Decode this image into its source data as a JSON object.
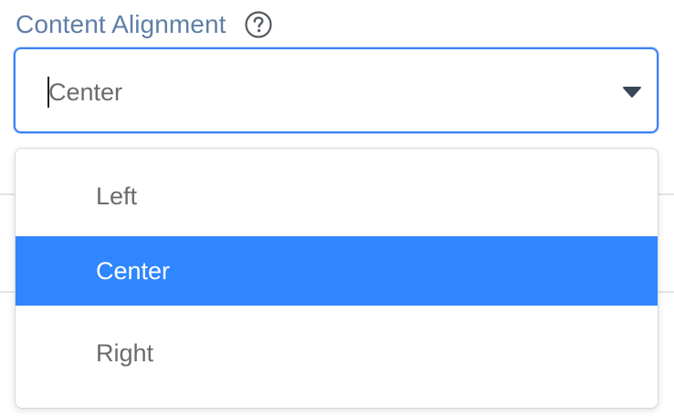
{
  "field": {
    "label": "Content Alignment",
    "help_icon": "question-circle-icon"
  },
  "select": {
    "value": "Center",
    "arrow_icon": "caret-down-icon",
    "border_color": "#3b82f6",
    "open": true
  },
  "options": [
    {
      "label": "Left",
      "selected": false
    },
    {
      "label": "Center",
      "selected": true
    },
    {
      "label": "Right",
      "selected": false
    }
  ],
  "colors": {
    "label": "#5f7ea6",
    "selected_bg": "#2f86ff",
    "selected_text": "#ffffff",
    "option_text": "#6b6b6b"
  }
}
